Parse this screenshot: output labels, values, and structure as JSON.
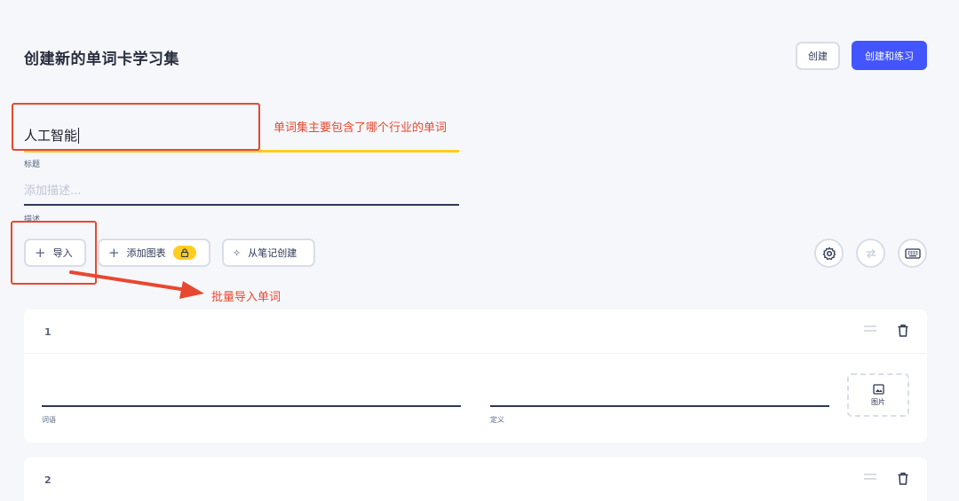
{
  "header": {
    "title": "创建新的单词卡学习集",
    "create_label": "创建",
    "create_practice_label": "创建和练习"
  },
  "title_field": {
    "value": "人工智能",
    "label": "标题"
  },
  "description_field": {
    "placeholder": "添加描述...",
    "label": "描述"
  },
  "toolbar": {
    "import_label": "导入",
    "add_chart_label": "添加图表",
    "from_notes_label": "从笔记创建"
  },
  "annotations": {
    "title_note": "单词集主要包含了哪个行业的单词",
    "import_note": "批量导入单词"
  },
  "cards": [
    {
      "number": "1",
      "term_label": "词语",
      "definition_label": "定义",
      "image_label": "图片"
    },
    {
      "number": "2"
    }
  ],
  "colors": {
    "accent": "#4255ff",
    "highlight": "#ffcd1f",
    "annotation": "#e8482f"
  },
  "icons": [
    "plus-icon",
    "lock-icon",
    "sparkle-icon",
    "gear-icon",
    "swap-icon",
    "keyboard-icon",
    "drag-handle-icon",
    "trash-icon",
    "image-icon"
  ]
}
